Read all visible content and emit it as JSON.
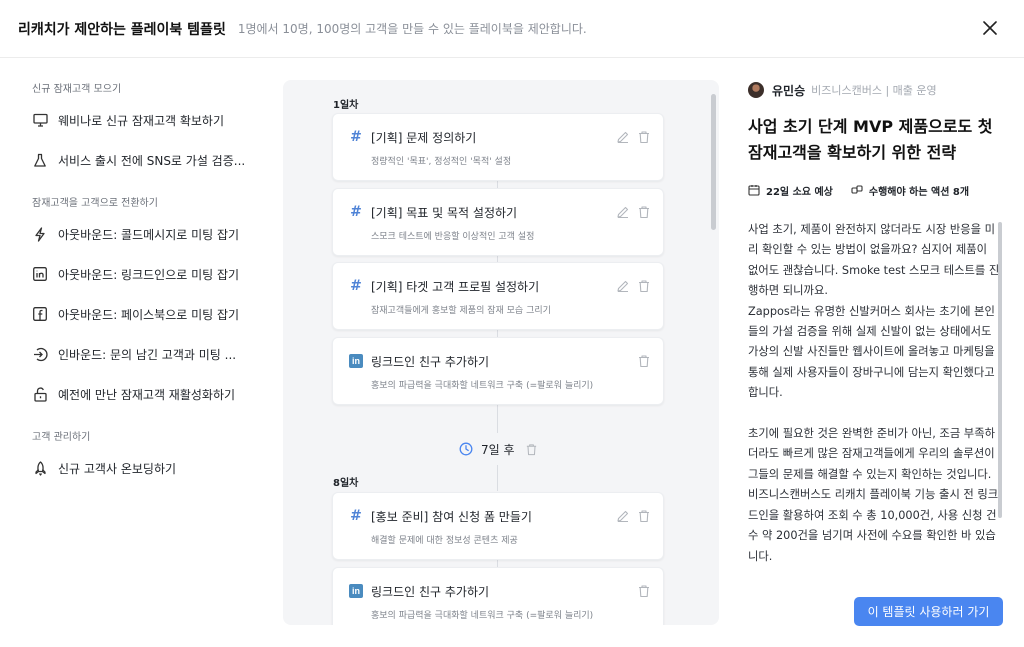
{
  "header": {
    "title": "리캐치가 제안하는 플레이북 템플릿",
    "subtitle": "1명에서 10명, 100명의 고객을 만들 수 있는 플레이북을 제안합니다."
  },
  "sidebar": {
    "sections": [
      {
        "title": "신규 잠재고객 모으기",
        "items": [
          {
            "label": "웨비나로 신규 잠재고객 확보하기",
            "icon": "monitor-icon"
          },
          {
            "label": "서비스 출시 전에 SNS로 가설 검증...",
            "icon": "flask-icon"
          }
        ]
      },
      {
        "title": "잠재고객을 고객으로 전환하기",
        "items": [
          {
            "label": "아웃바운드: 콜드메시지로 미팅 잡기",
            "icon": "lightning-icon"
          },
          {
            "label": "아웃바운드: 링크드인으로 미팅 잡기",
            "icon": "linkedin-icon"
          },
          {
            "label": "아웃바운드: 페이스북으로 미팅 잡기",
            "icon": "facebook-icon"
          },
          {
            "label": "인바운드: 문의 남긴 고객과 미팅 ...",
            "icon": "login-icon"
          },
          {
            "label": "예전에 만난 잠재고객 재활성화하기",
            "icon": "unlock-icon"
          }
        ]
      },
      {
        "title": "고객 관리하기",
        "items": [
          {
            "label": "신규 고객사 온보딩하기",
            "icon": "rocket-icon"
          }
        ]
      }
    ]
  },
  "timeline": {
    "day1_label": "1일차",
    "day8_label": "8일차",
    "wait_label": "7일 후",
    "cards": [
      {
        "title": "[기획] 문제 정의하기",
        "desc": "정량적인 '목표', 정성적인 '목적' 설정",
        "icon": "hash-icon",
        "hash": "#"
      },
      {
        "title": "[기획] 목표 및 목적 설정하기",
        "desc": "스모크 테스트에 반응할 이상적인 고객 설정",
        "icon": "hash-icon",
        "hash": "#"
      },
      {
        "title": "[기획] 타겟 고객 프로필 설정하기",
        "desc": "잠재고객들에게 홍보할 제품의 잠재 모습 그리기",
        "icon": "hash-icon",
        "hash": "#"
      },
      {
        "title": "링크드인 친구 추가하기",
        "desc": "홍보의 파급력을 극대화할 네트워크 구축 (=팔로워 늘리기)",
        "icon": "linkedin-icon",
        "badge": "in"
      },
      {
        "title": "[홍보 준비] 참여 신청 폼 만들기",
        "desc": "해결할 문제에 대한 정보성 콘텐츠 제공",
        "icon": "hash-icon",
        "hash": "#"
      },
      {
        "title": "링크드인 친구 추가하기",
        "desc": "홍보의 파급력을 극대화할 네트워크 구축 (=팔로워 늘리기)",
        "icon": "linkedin-icon",
        "badge": "in"
      }
    ]
  },
  "detail": {
    "author_name": "유민승",
    "author_role": "비즈니스캔버스 | 매출 운영",
    "title": "사업 초기 단계 MVP 제품으로도 첫 잠재고객을 확보하기 위한 전략",
    "duration": "22일 소요 예상",
    "actions": "수행해야 하는 액션 8개",
    "description": "사업 초기, 제품이 완전하지 않더라도 시장 반응을 미리 확인할 수 있는 방법이 없을까요? 심지어 제품이 없어도 괜찮습니다. Smoke test 스모크 테스트를 진행하면 되니까요.\nZappos라는 유명한 신발커머스 회사는 초기에 본인들의 가설 검증을 위해 실제 신발이 없는 상태에서도 가상의 신발 사진들만 웹사이트에 올려놓고 마케팅을 통해 실제 사용자들이 장바구니에 담는지 확인했다고 합니다.\n\n초기에 필요한 것은 완벽한 준비가 아닌, 조금 부족하더라도 빠르게 많은 잠재고객들에게 우리의 솔루션이 그들의 문제를 해결할 수 있는지 확인하는 것입니다. 비즈니스캔버스도 리캐치 플레이북 기능 출시 전 링크드인을 활용하여 조회 수 총 10,000건, 사용 신청 건수 약 200건을 넘기며 사전에 수요를 확인한 바 있습니다.",
    "cta_label": "이 템플릿 사용하러 가기"
  },
  "colors": {
    "accent": "#4a86f0",
    "hash": "#4f83d6",
    "linkedin": "#4a8bbf",
    "panel_bg": "#f4f5f7"
  }
}
